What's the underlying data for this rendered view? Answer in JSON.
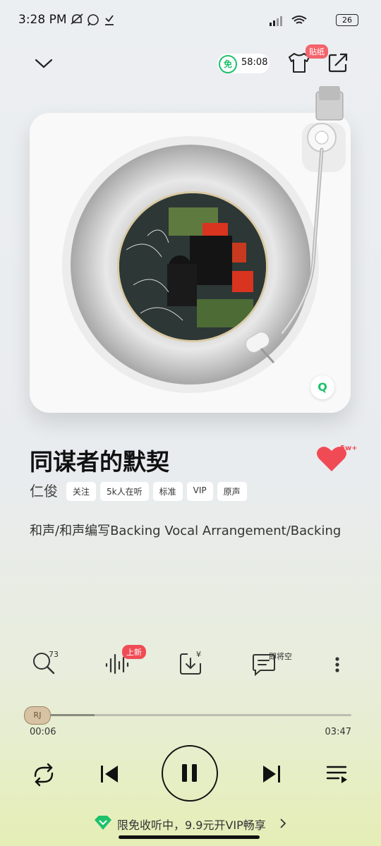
{
  "status_bar": {
    "time": "3:28 PM",
    "battery": "26",
    "icons": [
      "mute-bell-icon",
      "whatsapp-icon",
      "download-done-icon",
      "signal-icon",
      "wifi-icon"
    ]
  },
  "top_bar": {
    "free_badge": "免",
    "timer": "58:08",
    "sticker_badge": "贴纸"
  },
  "song": {
    "title": "同谋者的默契",
    "artist": "仁俊",
    "tags": [
      "关注",
      "5k人在听",
      "标准",
      "VIP",
      "原声"
    ],
    "like_count": "5w+",
    "credits": "和声/和声编写Backing Vocal Arrangement/Backing"
  },
  "actions": {
    "search_count": "73",
    "new_badge": "上新",
    "download_price": "¥",
    "comment_label": "即将空"
  },
  "player": {
    "knob_label": "RJ",
    "current_time": "00:06",
    "total_time": "03:47",
    "progress": 0.026
  },
  "promo": {
    "text": "限免收听中，9.9元开VIP畅享"
  },
  "colors": {
    "accent_green": "#1ec16b",
    "like_red": "#f04b55"
  }
}
